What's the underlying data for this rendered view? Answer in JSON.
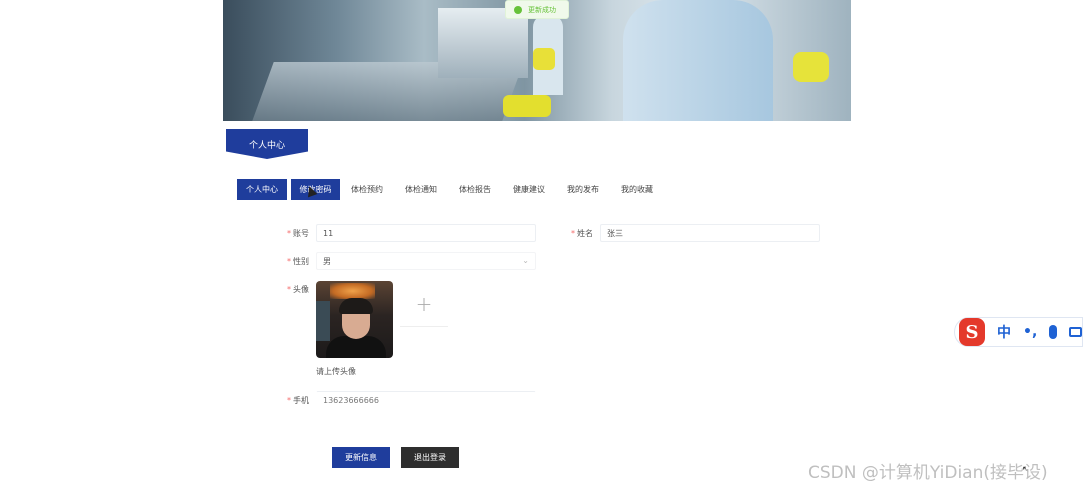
{
  "toast": {
    "text": "更新成功"
  },
  "section_title": "个人中心",
  "tabs": [
    {
      "label": "个人中心",
      "active": true
    },
    {
      "label": "修改密码",
      "hover": true
    },
    {
      "label": "体检预约"
    },
    {
      "label": "体检通知"
    },
    {
      "label": "体检报告"
    },
    {
      "label": "健康建议"
    },
    {
      "label": "我的发布"
    },
    {
      "label": "我的收藏"
    }
  ],
  "form": {
    "account": {
      "label": "账号",
      "value": "11"
    },
    "name": {
      "label": "姓名",
      "value": "张三"
    },
    "gender": {
      "label": "性别",
      "value": "男"
    },
    "avatar": {
      "label": "头像",
      "hint": "请上传头像"
    },
    "phone": {
      "label": "手机",
      "value": "13623666666"
    },
    "required_mark": "*"
  },
  "buttons": {
    "update": "更新信息",
    "logout": "退出登录"
  },
  "ime": {
    "logo": "S",
    "mode": "中",
    "punct": "•,"
  },
  "watermark": "CSDN @计算机YiDian(接毕设)",
  "colors": {
    "primary": "#1f3d9c",
    "dark_button": "#2e2e2e",
    "required": "#f56c6c",
    "toast": "#67c23a"
  }
}
